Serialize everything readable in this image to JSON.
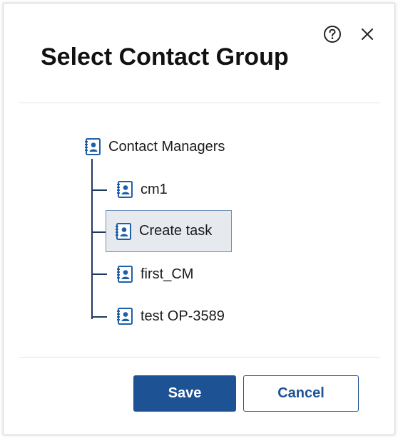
{
  "dialog": {
    "title": "Select Contact Group",
    "help_icon": "question-circle-icon",
    "close_icon": "close-icon"
  },
  "tree": {
    "root": {
      "label": "Contact Managers",
      "icon": "contact-book-icon"
    },
    "children": [
      {
        "label": "cm1",
        "icon": "contact-book-icon",
        "selected": false
      },
      {
        "label": "Create task",
        "icon": "contact-book-icon",
        "selected": true
      },
      {
        "label": "first_CM",
        "icon": "contact-book-icon",
        "selected": false
      },
      {
        "label": "test OP-3589",
        "icon": "contact-book-icon",
        "selected": false
      }
    ]
  },
  "buttons": {
    "save_label": "Save",
    "cancel_label": "Cancel"
  },
  "colors": {
    "primary": "#1d5294",
    "selected_bg": "#e6e9ee",
    "selected_border": "#6d8fb8",
    "icon": "#1f5fa8"
  }
}
